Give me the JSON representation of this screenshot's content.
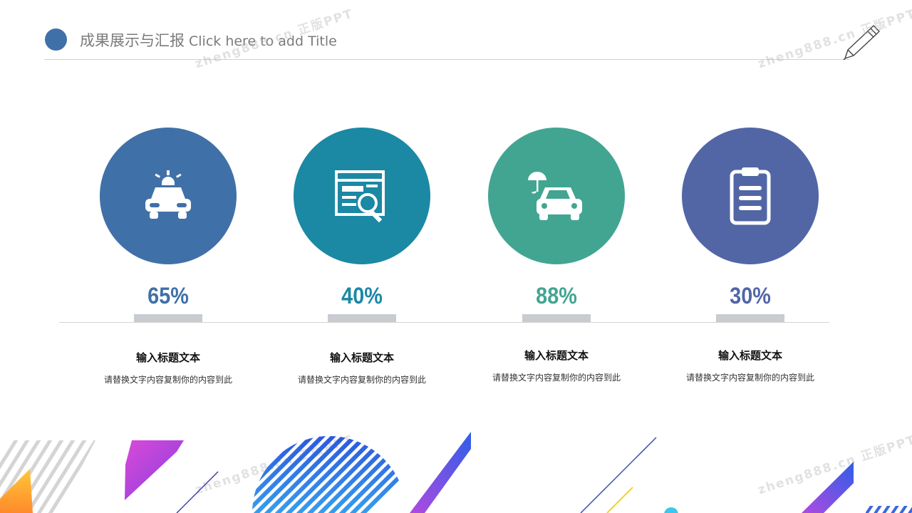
{
  "header": {
    "title": "成果展示与汇报",
    "subtitle": "Click here to add Title"
  },
  "colors": {
    "accent_blue": "#4070a8",
    "teal_blue": "#1b88a4",
    "green": "#42a592",
    "indigo": "#5266a6"
  },
  "watermark": {
    "text_1": "zheng888.cn 正版PPT",
    "text_2": "zheng888.cn 正版PPT",
    "text_3": "zheng888.cn 正版PPT",
    "text_4": "zheng888.cn 正版PPT"
  },
  "cards": [
    {
      "icon": "police-car-icon",
      "color": "#4070a8",
      "value": "65%",
      "title": "输入标题文本",
      "desc": "请替换文字内容复制你的内容到此"
    },
    {
      "icon": "search-document-icon",
      "color": "#1b88a4",
      "value": "40%",
      "title": "输入标题文本",
      "desc": "请替换文字内容复制你的内容到此"
    },
    {
      "icon": "car-insurance-icon",
      "color": "#42a592",
      "value": "88%",
      "title": "输入标题文本",
      "desc": "请替换文字内容复制你的内容到此"
    },
    {
      "icon": "clipboard-icon",
      "color": "#5266a6",
      "value": "30%",
      "title": "输入标题文本",
      "desc": "请替换文字内容复制你的内容到此"
    }
  ]
}
